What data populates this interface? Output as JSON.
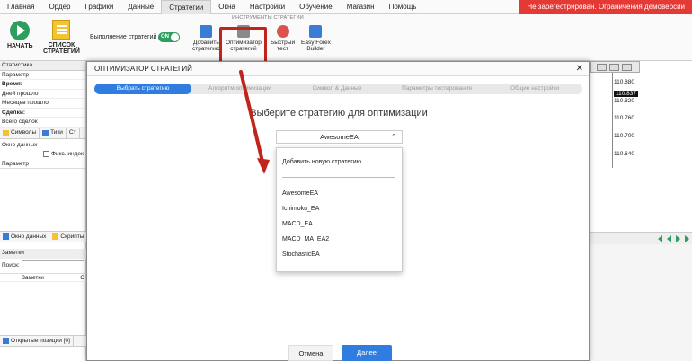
{
  "menu": {
    "items": [
      "Главная",
      "Ордер",
      "Графики",
      "Данные",
      "Стратегии",
      "Окна",
      "Настройки",
      "Обучение",
      "Магазин",
      "Помощь"
    ],
    "active_index": 4,
    "warning": "Не зарегестрирован. Ограничения демоверсии"
  },
  "ribbon": {
    "start_label": "НАЧАТЬ",
    "list_label_1": "СПИСОК",
    "list_label_2": "СТРАТЕГИЙ",
    "exec_label": "Выполнение стратегий",
    "toggle_label": "ON",
    "group_label": "ИНСТРУМЕНТЫ СТРАТЕГИИ",
    "add_1": "Добавить",
    "add_2": "стратегию",
    "opt_1": "Оптимизатор",
    "opt_2": "стратегий",
    "fast_1": "Быстрый",
    "fast_2": "тест",
    "easy_1": "Easy Forex",
    "easy_2": "Builder"
  },
  "left_panel": {
    "title": "Статистика",
    "rows": [
      "Параметр",
      "Время:",
      "Дней прошло",
      "Месяцев прошло",
      "Сделки:",
      "Всего сделок"
    ],
    "bold_rows": [
      1,
      4
    ],
    "tabs": [
      "Символы",
      "Тики",
      "Ст"
    ],
    "data_window": "Окно данных",
    "fix_label": "Фикс. индек",
    "param": "Параметр",
    "bottom_tabs": [
      "Окно данных",
      "Скрипты"
    ],
    "notes_title": "Заметки",
    "search_label": "Поиск:",
    "notes_col_1": "Заметки",
    "notes_col_2": "С",
    "open_positions": "Открытые позиции [0]"
  },
  "chart": {
    "prices": [
      "110.880",
      "110.837",
      "110.820",
      "110.760",
      "110.700",
      "110.640"
    ],
    "current_index": 1
  },
  "dialog": {
    "title": "ОПТИМИЗАТОР СТРАТЕГИЙ",
    "steps": [
      "Выбрать стратегию",
      "Алгоритм оптимизации",
      "Символ & Данные",
      "Параметры тестирования",
      "Общие настройки"
    ],
    "active_step": 0,
    "heading": "Выберите стратегию для оптимизации",
    "selected": "AwesomeEA",
    "add_new": "Добавить новую стратегию",
    "options": [
      "AwesomeEA",
      "Ichimoku_EA",
      "MACD_EA",
      "MACD_MA_EA2",
      "StochasticEA"
    ],
    "cancel": "Отмена",
    "next": "Далее"
  },
  "colors": {
    "accent": "#2f7de1",
    "start": "#2e9e5e",
    "warning": "#e53935",
    "highlight": "#c0241c"
  }
}
